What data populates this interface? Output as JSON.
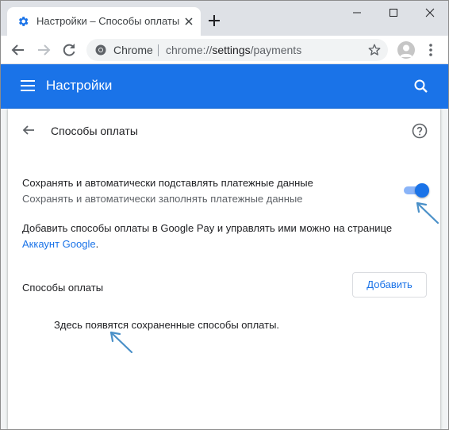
{
  "tab": {
    "title": "Настройки – Способы оплаты"
  },
  "toolbar": {
    "omnibox_label": "Chrome",
    "url_scheme": "chrome://",
    "url_host": "settings",
    "url_path": "/payments"
  },
  "header": {
    "title": "Настройки"
  },
  "payments": {
    "section_title": "Способы оплаты",
    "toggle": {
      "label": "Сохранять и автоматически подставлять платежные данные",
      "sublabel": "Сохранять и автоматически заполнять платежные данные",
      "enabled": true
    },
    "gpay_text": "Добавить способы оплаты в Google Pay и управлять ими можно на странице",
    "gpay_link": "Аккаунт Google",
    "gpay_link_suffix": ".",
    "methods_label": "Способы оплаты",
    "add_button": "Добавить",
    "empty_text": "Здесь появятся сохраненные способы оплаты."
  },
  "icons": {
    "tab_favicon": "gear-icon",
    "back": "arrow-back-icon",
    "forward": "arrow-forward-icon",
    "reload": "reload-icon",
    "omnibox": "chrome-logo-icon",
    "bookmark": "star-icon",
    "profile": "avatar-icon",
    "menu": "more-vert-icon",
    "hamburger": "menu-icon",
    "search": "search-icon",
    "help": "help-icon"
  },
  "colors": {
    "accent": "#1a73e8",
    "toggle_track": "#8ab4f8",
    "annotation_arrow": "#4a90c8"
  }
}
